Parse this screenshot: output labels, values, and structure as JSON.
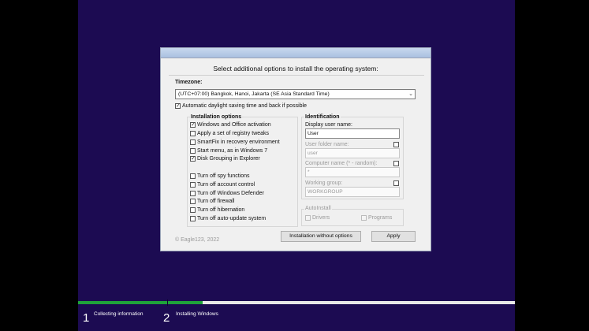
{
  "dialog": {
    "heading": "Select additional options to install the operating system:",
    "timezone_label": "Timezone:",
    "timezone_value": "(UTC+07:00) Bangkok, Hanoi, Jakarta (SE Asia Standard Time)",
    "dst_label": "Automatic daylight saving time and back if possible",
    "dst_checked": true,
    "install_options_title": "Installation options",
    "install_options": [
      {
        "label": "Windows and Office activation",
        "checked": true
      },
      {
        "label": "Apply a set of registry tweaks",
        "checked": false
      },
      {
        "label": "SmartFix in recovery environment",
        "checked": false
      },
      {
        "label": "Start menu, as in Windows 7",
        "checked": false
      },
      {
        "label": "Disk Grouping in Explorer",
        "checked": true
      },
      {
        "label": "Turn off spy functions",
        "checked": false
      },
      {
        "label": "Turn off account control",
        "checked": false
      },
      {
        "label": "Turn off Windows Defender",
        "checked": false
      },
      {
        "label": "Turn off firewall",
        "checked": false
      },
      {
        "label": "Turn off hibernation",
        "checked": false
      },
      {
        "label": "Turn off auto-update system",
        "checked": false
      }
    ],
    "identification": {
      "title": "Identification",
      "display_user_label": "Display user name:",
      "display_user_value": "User",
      "user_folder_label": "User folder name:",
      "user_folder_value": "user",
      "computer_name_label": "Computer name (* - random):",
      "computer_name_value": "*",
      "working_group_label": "Working group:",
      "working_group_value": "WORKGROUP"
    },
    "autoinstall": {
      "title": "AutoInstall",
      "drivers_label": "Drivers",
      "programs_label": "Programs"
    },
    "copyright": "© Eagle123, 2022",
    "btn_install_without": "Installation without options",
    "btn_apply": "Apply"
  },
  "progress": {
    "steps": [
      {
        "number": "1",
        "label": "Collecting information"
      },
      {
        "number": "2",
        "label": "Installing Windows"
      }
    ],
    "step1_fill": 1.0,
    "step2_fill": 0.1,
    "fill_color": "#1fa33a",
    "track_color": "#e8e8e8"
  }
}
